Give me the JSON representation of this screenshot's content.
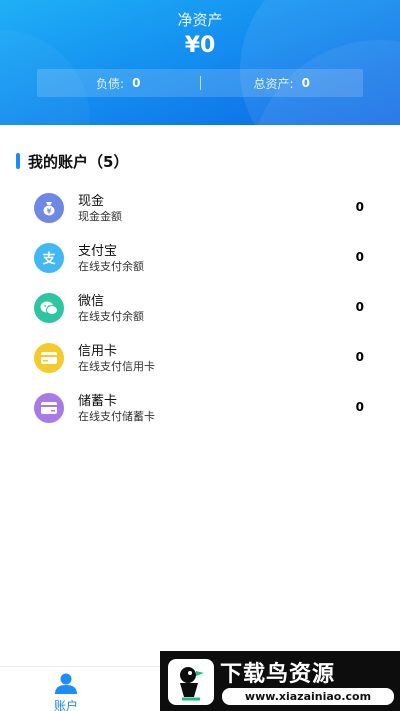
{
  "header": {
    "net_assets_label": "净资产",
    "net_assets_value": "¥0",
    "liabilities_label": "负债:",
    "liabilities_value": "0",
    "total_assets_label": "总资产:",
    "total_assets_value": "0"
  },
  "accounts_section": {
    "title": "我的账户（5）",
    "accent_color": "#1e8cf5",
    "items": [
      {
        "name": "现金",
        "subtitle": "现金金额",
        "amount": "0",
        "icon": "money-bag-icon",
        "color": "#6f88e6"
      },
      {
        "name": "支付宝",
        "subtitle": "在线支付余额",
        "amount": "0",
        "icon": "alipay-icon",
        "color": "#41b8f4"
      },
      {
        "name": "微信",
        "subtitle": "在线支付余额",
        "amount": "0",
        "icon": "wechat-icon",
        "color": "#2ec6a0"
      },
      {
        "name": "信用卡",
        "subtitle": "在线支付信用卡",
        "amount": "0",
        "icon": "credit-card-icon",
        "color": "#f4cb2c"
      },
      {
        "name": "储蓄卡",
        "subtitle": "在线支付储蓄卡",
        "amount": "0",
        "icon": "debit-card-icon",
        "color": "#a87ae6"
      }
    ]
  },
  "tabbar": {
    "accounts_label": "账户",
    "active_color": "#1e8cf5"
  },
  "watermark": {
    "title": "下载鸟资源",
    "url": "www.xiazainiao.com"
  }
}
